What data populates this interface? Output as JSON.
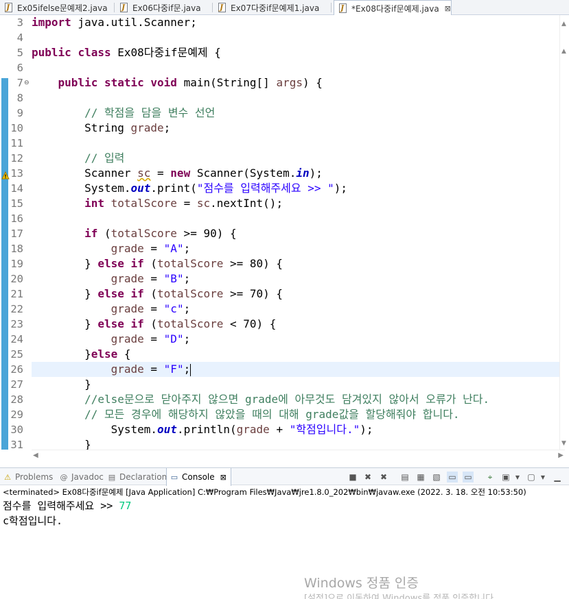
{
  "tabs": [
    {
      "label": "Ex05ifelse문예제2.java",
      "active": false
    },
    {
      "label": "Ex06다중if문.java",
      "active": false
    },
    {
      "label": "Ex07다중if문예제1.java",
      "active": false
    },
    {
      "label": "*Ex08다중if문예제.java",
      "active": true
    }
  ],
  "tab_close_glyph": "⊠",
  "editor": {
    "current_line": 26,
    "lines": [
      {
        "n": "3",
        "html": "<span class=\"kw\">import</span> java.util.Scanner;"
      },
      {
        "n": "4",
        "html": ""
      },
      {
        "n": "5",
        "html": "<span class=\"kw\">public</span> <span class=\"kw\">class</span> Ex08다중if문예제 {"
      },
      {
        "n": "6",
        "html": ""
      },
      {
        "n": "7",
        "html": "    <span class=\"kw\">public</span> <span class=\"kw\">static</span> <span class=\"kw\">void</span> main(String[] <span class=\"var\">args</span>) {",
        "fold": "⊖"
      },
      {
        "n": "8",
        "html": ""
      },
      {
        "n": "9",
        "html": "        <span class=\"cmt\">// 학점을 담을 변수 선언</span>"
      },
      {
        "n": "10",
        "html": "        String <span class=\"var\">grade</span>;"
      },
      {
        "n": "11",
        "html": ""
      },
      {
        "n": "12",
        "html": "        <span class=\"cmt\">// 입력</span>"
      },
      {
        "n": "13",
        "html": "        Scanner <span class=\"var\" style=\"text-decoration: underline wavy #d6a800;\">sc</span> = <span class=\"kw\">new</span> Scanner(System.<span class=\"fld\">in</span>);",
        "warn": true
      },
      {
        "n": "14",
        "html": "        System.<span class=\"fld\">out</span>.print(<span class=\"str\">\"점수를 입력해주세요 >> \"</span>);"
      },
      {
        "n": "15",
        "html": "        <span class=\"kw\">int</span> <span class=\"var\">totalScore</span> = <span class=\"var\">sc</span>.nextInt();"
      },
      {
        "n": "16",
        "html": ""
      },
      {
        "n": "17",
        "html": "        <span class=\"kw\">if</span> (<span class=\"var\">totalScore</span> >= 90) {"
      },
      {
        "n": "18",
        "html": "            <span class=\"var\">grade</span> = <span class=\"str\">\"A\"</span>;"
      },
      {
        "n": "19",
        "html": "        } <span class=\"kw\">else</span> <span class=\"kw\">if</span> (<span class=\"var\">totalScore</span> >= 80) {"
      },
      {
        "n": "20",
        "html": "            <span class=\"var\">grade</span> = <span class=\"str\">\"B\"</span>;"
      },
      {
        "n": "21",
        "html": "        } <span class=\"kw\">else</span> <span class=\"kw\">if</span> (<span class=\"var\">totalScore</span> >= 70) {"
      },
      {
        "n": "22",
        "html": "            <span class=\"var\">grade</span> = <span class=\"str\">\"c\"</span>;"
      },
      {
        "n": "23",
        "html": "        } <span class=\"kw\">else</span> <span class=\"kw\">if</span> (<span class=\"var\">totalScore</span> < 70) {"
      },
      {
        "n": "24",
        "html": "            <span class=\"var\">grade</span> = <span class=\"str\">\"D\"</span>;"
      },
      {
        "n": "25",
        "html": "        }<span class=\"kw\">else</span> {"
      },
      {
        "n": "26",
        "html": "            <span class=\"var\">grade</span> = <span class=\"str\">\"F\"</span>;<span class=\"caret\"></span>"
      },
      {
        "n": "27",
        "html": "        }"
      },
      {
        "n": "28",
        "html": "        <span class=\"cmt\">//else문으로 닫아주지 않으면 grade에 아무것도 담겨있지 않아서 오류가 난다.</span>"
      },
      {
        "n": "29",
        "html": "        <span class=\"cmt\">// 모든 경우에 해당하지 않았을 때의 대해 grade값을 할당해줘야 합니다.</span>"
      },
      {
        "n": "30",
        "html": "            System.<span class=\"fld\">out</span>.println(<span class=\"var\">grade</span> + <span class=\"str\">\"학점입니다.\"</span>);"
      },
      {
        "n": "31",
        "html": "        }"
      }
    ]
  },
  "views": {
    "tabs": [
      {
        "label": "Problems",
        "icon": "problems-icon",
        "glyph": "⚠",
        "active": false
      },
      {
        "label": "Javadoc",
        "icon": "javadoc-icon",
        "glyph": "@",
        "active": false
      },
      {
        "label": "Declaration",
        "icon": "declaration-icon",
        "glyph": "▤",
        "active": false
      },
      {
        "label": "Console",
        "icon": "console-icon",
        "glyph": "▭",
        "active": true
      }
    ],
    "close_glyph": "⊠"
  },
  "console": {
    "status": "<terminated> Ex08다중if문예제 [Java Application] C:₩Program Files₩Java₩jre1.8.0_202₩bin₩javaw.exe (2022. 3. 18. 오전 10:53:50)",
    "prompt": "점수를 입력해주세요 >> ",
    "input": "77",
    "output": "c학점입니다."
  },
  "watermark": {
    "title": "Windows 정품 인증",
    "subtitle": "[설정]으로 이동하여 Windows를 정품 인증합니다."
  }
}
